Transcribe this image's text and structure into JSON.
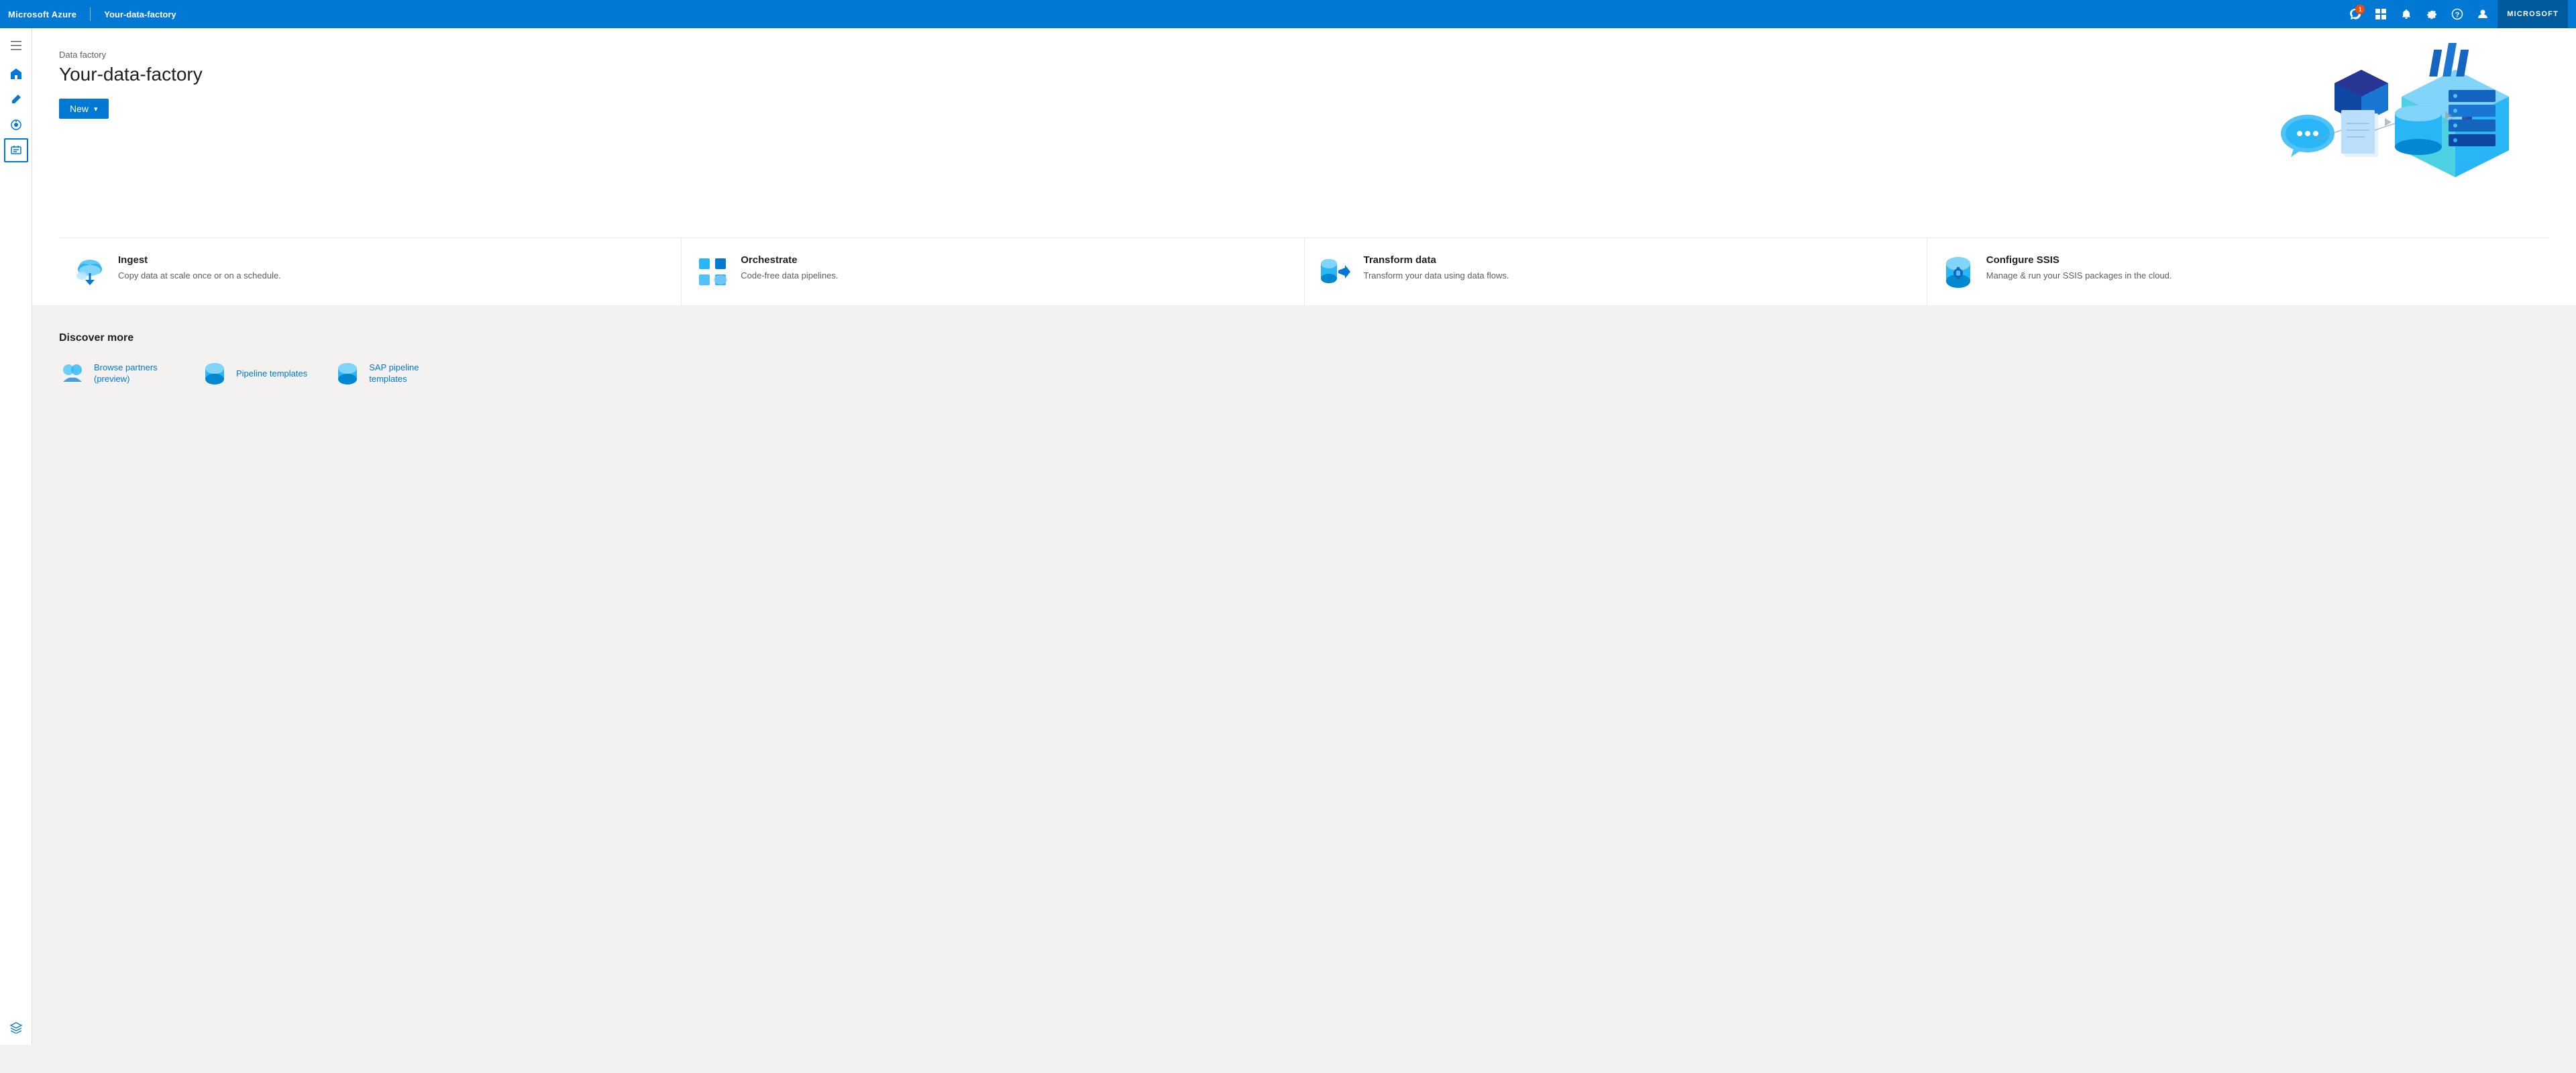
{
  "topNav": {
    "brand": "Microsoft Azure",
    "divider": "|",
    "pageTitle": "Your-data-factory",
    "userLabel": "MICROSOFT",
    "notificationCount": "1",
    "icons": {
      "feedback": "💬",
      "portal": "⊞",
      "notifications": "🔔",
      "settings": "⚙",
      "help": "?",
      "profile": "👤"
    }
  },
  "sidebar": {
    "toggle": "≡",
    "items": [
      {
        "id": "home",
        "label": "Home",
        "icon": "home"
      },
      {
        "id": "author",
        "label": "Author",
        "icon": "pencil"
      },
      {
        "id": "monitor",
        "label": "Monitor",
        "icon": "monitor"
      },
      {
        "id": "manage",
        "label": "Manage",
        "icon": "briefcase",
        "active": true
      }
    ],
    "bottomItems": [
      {
        "id": "learn",
        "label": "Learn",
        "icon": "graduation"
      }
    ]
  },
  "hero": {
    "breadcrumb": "Data factory",
    "title": "Your-data-factory",
    "newButton": "New",
    "chevron": "▾"
  },
  "actionCards": [
    {
      "id": "ingest",
      "title": "Ingest",
      "description": "Copy data at scale once or on a schedule."
    },
    {
      "id": "orchestrate",
      "title": "Orchestrate",
      "description": "Code-free data pipelines."
    },
    {
      "id": "transform",
      "title": "Transform data",
      "description": "Transform your data using data flows."
    },
    {
      "id": "configure-ssis",
      "title": "Configure SSIS",
      "description": "Manage & run your SSIS packages in the cloud."
    }
  ],
  "discoverMore": {
    "title": "Discover more",
    "items": [
      {
        "id": "browse-partners",
        "label": "Browse partners (preview)"
      },
      {
        "id": "pipeline-templates",
        "label": "Pipeline templates"
      },
      {
        "id": "sap-pipeline-templates",
        "label": "SAP pipeline templates"
      }
    ]
  }
}
